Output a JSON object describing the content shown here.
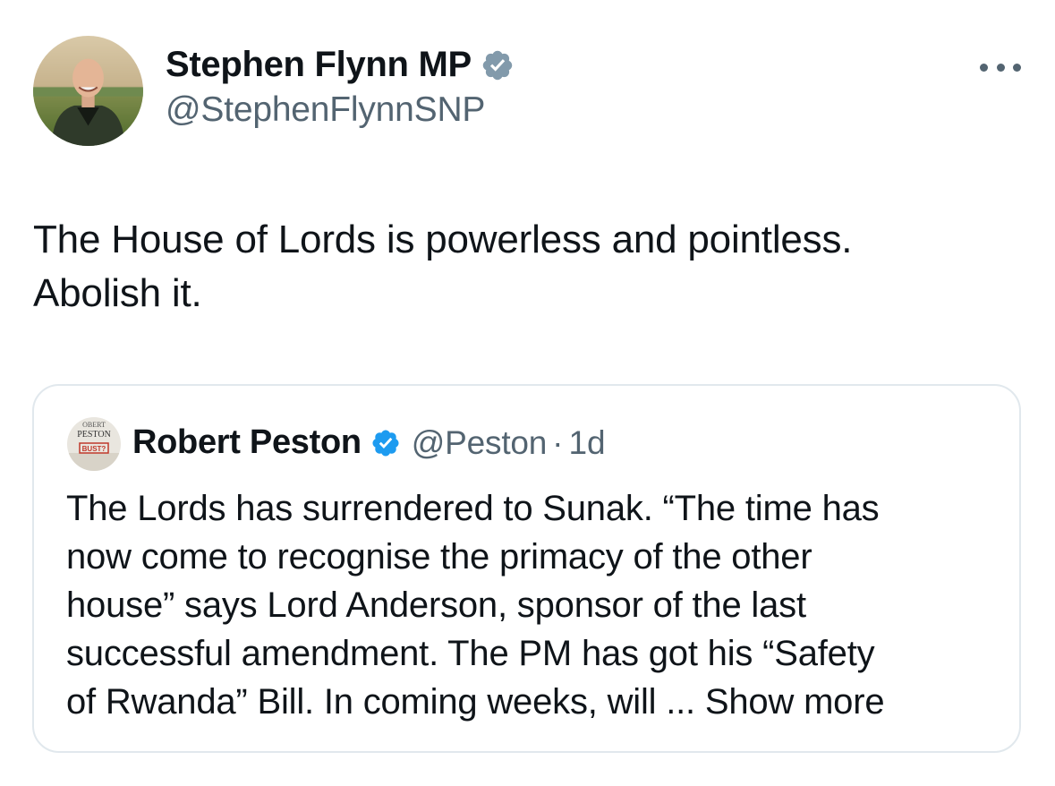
{
  "tweet": {
    "author": {
      "display_name": "Stephen Flynn MP",
      "handle": "@StephenFlynnSNP",
      "verified": true,
      "verified_icon": "verified-badge-gray"
    },
    "more_icon": "more-horizontal-icon",
    "text_line1": "The House of Lords is powerless and pointless.",
    "text_line2": "Abolish it.",
    "quote": {
      "display_name": "Robert Peston",
      "handle": "@Peston",
      "separator": "·",
      "time": "1d",
      "verified": true,
      "verified_icon": "verified-badge-blue",
      "avatar_text": {
        "top": "OBERT",
        "title": "PESTON",
        "stamp": "BUST?"
      },
      "text_lines": [
        "The Lords has surrendered to Sunak.  “The time has",
        "now come to recognise the primacy of the other",
        "house” says Lord Anderson, sponsor of the last",
        "successful amendment.  The PM has got his “Safety",
        "of Rwanda” Bill. In coming weeks, will ... "
      ],
      "show_more": "Show more"
    }
  },
  "colors": {
    "text_primary": "#0f1419",
    "text_secondary": "#536471",
    "verified_gray": "#829aab",
    "verified_blue": "#1d9bf0",
    "card_border": "#e1e8ed"
  }
}
